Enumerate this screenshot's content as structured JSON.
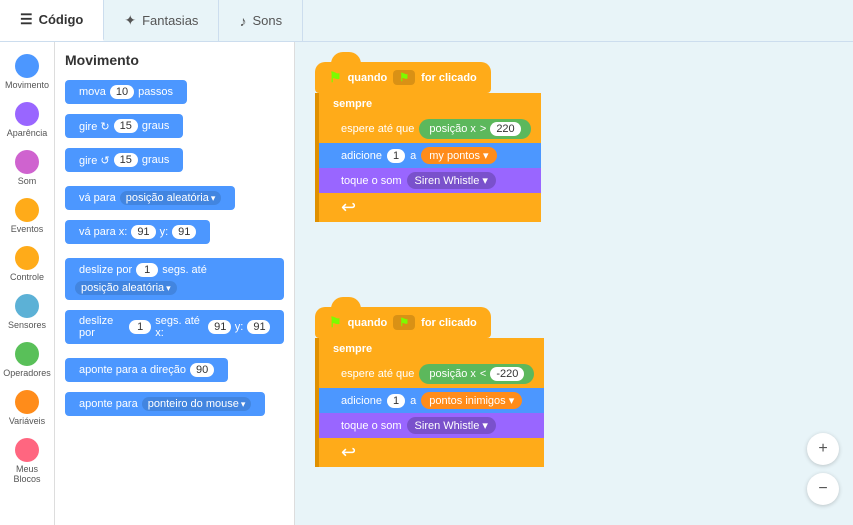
{
  "tabs": [
    {
      "id": "codigo",
      "label": "Código",
      "icon": "≡",
      "active": true
    },
    {
      "id": "fantasias",
      "label": "Fantasias",
      "icon": "✦",
      "active": false
    },
    {
      "id": "sons",
      "label": "Sons",
      "icon": "♪",
      "active": false
    }
  ],
  "sidebar": {
    "items": [
      {
        "id": "movimento",
        "label": "Movimento",
        "color": "#4C97FF"
      },
      {
        "id": "aparencia",
        "label": "Aparência",
        "color": "#9966FF"
      },
      {
        "id": "som",
        "label": "Som",
        "color": "#CF63CF"
      },
      {
        "id": "eventos",
        "label": "Eventos",
        "color": "#FFAB19"
      },
      {
        "id": "controle",
        "label": "Controle",
        "color": "#FFAB19"
      },
      {
        "id": "sensores",
        "label": "Sensores",
        "color": "#5CB1D6"
      },
      {
        "id": "operadores",
        "label": "Operadores",
        "color": "#59C059"
      },
      {
        "id": "variaveis",
        "label": "Variáveis",
        "color": "#FF8C1A"
      },
      {
        "id": "meus-blocos",
        "label": "Meus Blocos",
        "color": "#FF6680"
      }
    ]
  },
  "blocks_panel": {
    "title": "Movimento",
    "blocks": [
      {
        "type": "move",
        "text": "mova",
        "input": "10",
        "suffix": "passos"
      },
      {
        "type": "turn-cw",
        "text": "gire",
        "input": "15",
        "suffix": "graus"
      },
      {
        "type": "turn-ccw",
        "text": "gire",
        "input": "15",
        "suffix": "graus"
      },
      {
        "type": "goto",
        "text": "vá para",
        "dropdown": "posição aleatória"
      },
      {
        "type": "gotoxy",
        "text": "vá para x:",
        "input1": "91",
        "label": "y:",
        "input2": "91"
      },
      {
        "type": "glide1",
        "text": "deslize por",
        "input": "1",
        "mid": "segs. até",
        "dropdown": "posição aleatória"
      },
      {
        "type": "glide2",
        "text": "deslize por",
        "input": "1",
        "mid": "segs. até x:",
        "input2": "91",
        "label2": "y:",
        "input3": "91"
      },
      {
        "type": "direction",
        "text": "aponte  para a direção",
        "input": "90"
      },
      {
        "type": "pointto",
        "text": "aponte para",
        "dropdown": "ponteiro do mouse"
      }
    ]
  },
  "canvas": {
    "group1": {
      "hat": "quando 🚩 for clicado",
      "loop": "sempre",
      "wait": {
        "prefix": "espere até que",
        "reporter": "posição x",
        "op": ">",
        "val": "220"
      },
      "add": {
        "prefix": "adicione",
        "val": "1",
        "mid": "a",
        "var": "my pontos"
      },
      "sound": {
        "prefix": "toque o som",
        "dropdown": "Siren Whistle"
      }
    },
    "group2": {
      "hat": "quando 🚩 for clicado",
      "loop": "sempre",
      "wait": {
        "prefix": "espere até que",
        "reporter": "posição x",
        "op": "<",
        "val": "-220"
      },
      "add": {
        "prefix": "adicione",
        "val": "1",
        "mid": "a",
        "var": "pontos inimigos"
      },
      "sound": {
        "prefix": "toque o som",
        "dropdown": "Siren Whistle"
      }
    }
  },
  "zoom": {
    "in_label": "+",
    "out_label": "−"
  }
}
